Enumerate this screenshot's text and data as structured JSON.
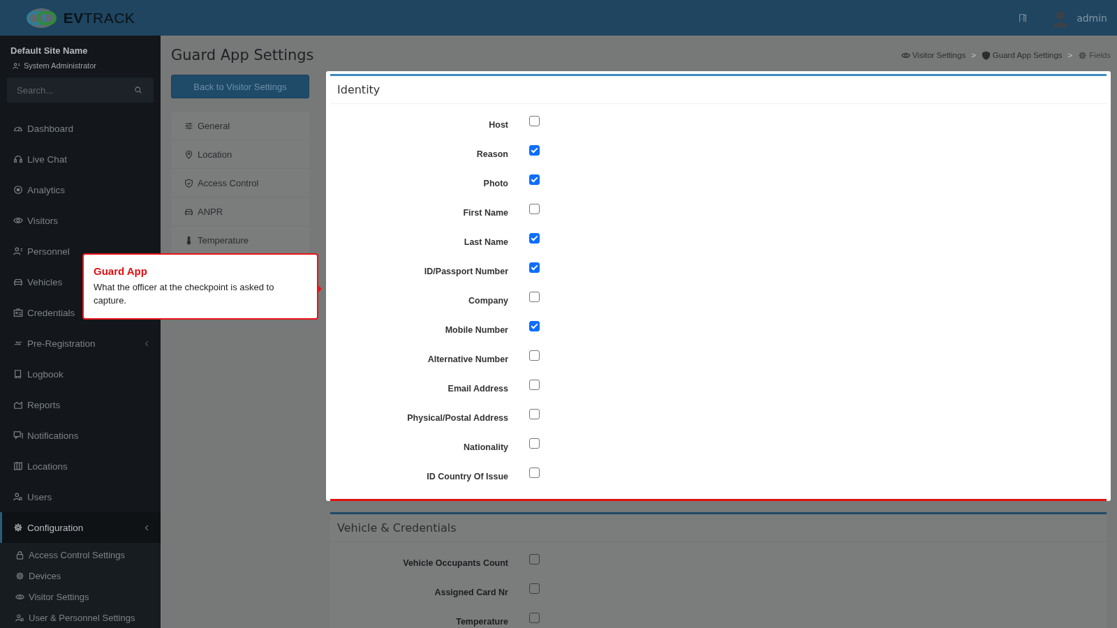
{
  "header": {
    "logo": "**EV**TRACK",
    "user": "admin"
  },
  "sidebar": {
    "site": "Default Site Name",
    "role": "System Administrator",
    "search": {
      "placeholder": "Search..."
    },
    "items": [
      {
        "label": "Dashboard",
        "expandable": false,
        "selected": false
      },
      {
        "label": "Live Chat",
        "expandable": false,
        "selected": false
      },
      {
        "label": "Analytics",
        "expandable": false,
        "selected": false
      },
      {
        "label": "Visitors",
        "expandable": false,
        "selected": false
      },
      {
        "label": "Personnel",
        "expandable": false,
        "selected": false
      },
      {
        "label": "Vehicles",
        "expandable": false,
        "selected": false
      },
      {
        "label": "Credentials",
        "expandable": false,
        "selected": false
      },
      {
        "label": "Pre-Registration",
        "expandable": true,
        "selected": false
      },
      {
        "label": "Logbook",
        "expandable": false,
        "selected": false
      },
      {
        "label": "Reports",
        "expandable": false,
        "selected": false
      },
      {
        "label": "Notifications",
        "expandable": false,
        "selected": false
      },
      {
        "label": "Locations",
        "expandable": false,
        "selected": false
      },
      {
        "label": "Users",
        "expandable": false,
        "selected": false
      },
      {
        "label": "Configuration",
        "expandable": true,
        "selected": true,
        "children": [
          {
            "label": "Access Control Settings"
          },
          {
            "label": "Devices"
          },
          {
            "label": "Visitor Settings"
          },
          {
            "label": "User & Personnel Settings"
          }
        ]
      }
    ]
  },
  "page": {
    "title": "Guard App Settings",
    "back_button": "Back to Visitor Settings",
    "breadcrumb": [
      {
        "kind": "link",
        "label": "Visitor Settings"
      },
      {
        "kind": "separator",
        "label": ">"
      },
      {
        "kind": "link",
        "label": "Guard App Settings"
      },
      {
        "kind": "separator",
        "label": ">"
      },
      {
        "kind": "current",
        "label": "Fields"
      }
    ],
    "tabs": [
      "General",
      "Location",
      "Access Control",
      "ANPR",
      "Temperature"
    ],
    "sections": [
      {
        "title": "Identity",
        "highlighted": true,
        "fields": [
          {
            "label": "Host",
            "checked": false
          },
          {
            "label": "Reason",
            "checked": true
          },
          {
            "label": "Photo",
            "checked": true
          },
          {
            "label": "First Name",
            "checked": false
          },
          {
            "label": "Last Name",
            "checked": true
          },
          {
            "label": "ID/Passport Number",
            "checked": true
          },
          {
            "label": "Company",
            "checked": false
          },
          {
            "label": "Mobile Number",
            "checked": true
          },
          {
            "label": "Alternative Number",
            "checked": false
          },
          {
            "label": "Email Address",
            "checked": false
          },
          {
            "label": "Physical/Postal Address",
            "checked": false
          },
          {
            "label": "Nationality",
            "checked": false
          },
          {
            "label": "ID Country Of Issue",
            "checked": false
          }
        ]
      },
      {
        "title": "Vehicle & Credentials",
        "highlighted": false,
        "fields": [
          {
            "label": "Vehicle Occupants Count",
            "checked": false
          },
          {
            "label": "Assigned Card Nr",
            "checked": false
          },
          {
            "label": "Temperature",
            "checked": false
          }
        ]
      }
    ]
  },
  "tour": {
    "title": "Guard App",
    "text": "What the officer at the checkpoint is asked to capture."
  }
}
